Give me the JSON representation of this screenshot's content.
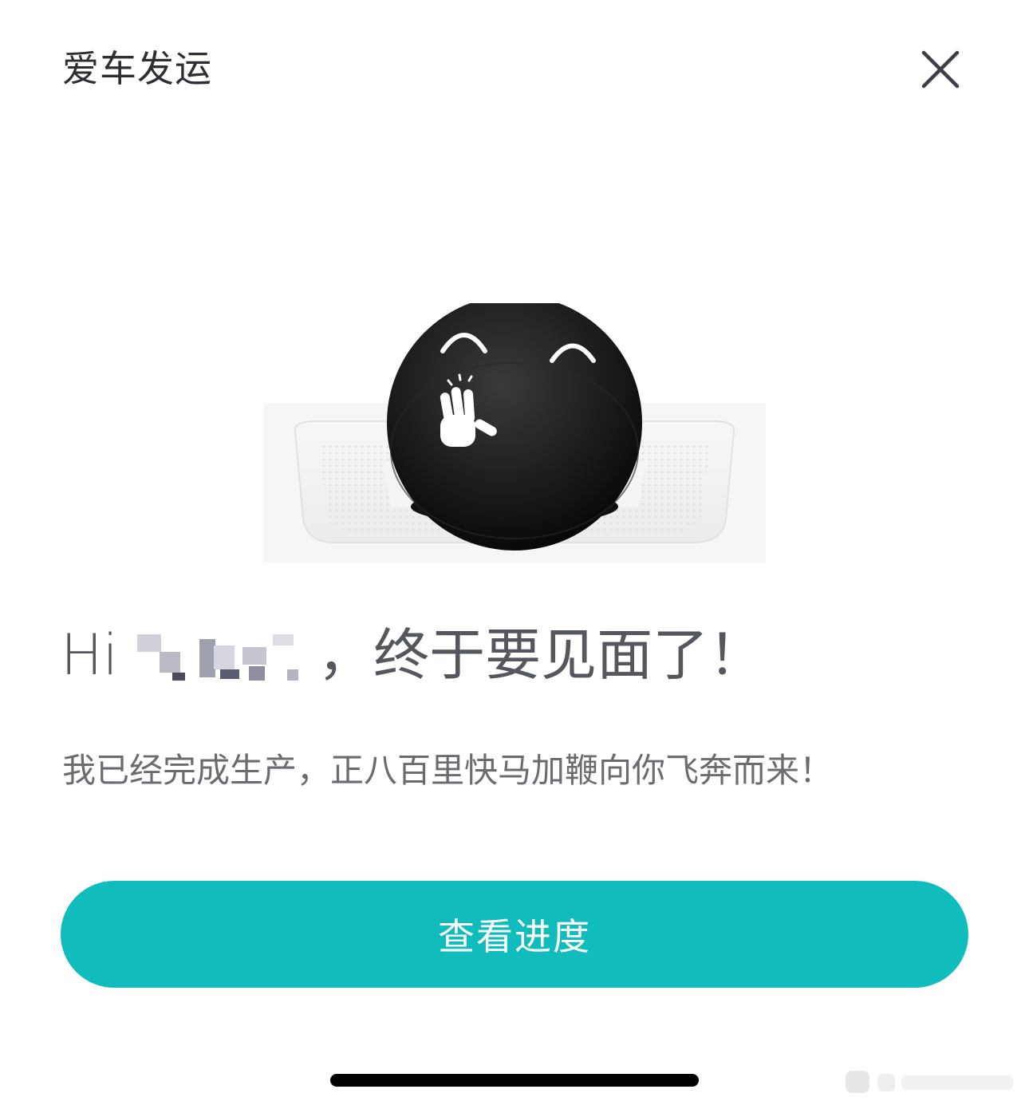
{
  "header": {
    "title": "爱车发运",
    "close_icon": "close-icon"
  },
  "main": {
    "illustration_icon": "smiley-waving-robot-icon",
    "greeting_prefix": "Hi",
    "greeting_suffix": "，终于要见面了！",
    "subtitle": "我已经完成生产，正八百里快马加鞭向你飞奔而来！"
  },
  "cta": {
    "label": "查看进度"
  },
  "colors": {
    "accent": "#10bcbc",
    "title_text": "#2d2d34",
    "body_text": "#6a6c72"
  }
}
